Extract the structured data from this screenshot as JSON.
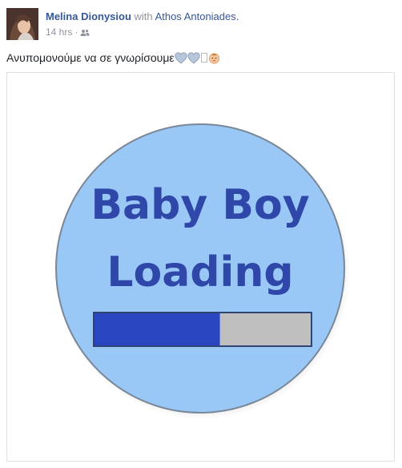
{
  "post": {
    "author": "Melina Dionysiou",
    "with_word": "with",
    "tagged": "Athos Antoniades.",
    "time": "14 hrs",
    "audience_icon": "friends-icon",
    "text": "Ανυπομονούμε να σε γνωρίσουμε",
    "emojis": [
      "blue-heart-icon",
      "blue-heart-icon",
      "missing-glyph",
      "baby-face-icon"
    ]
  },
  "image": {
    "line1": "Baby Boy",
    "line2": "Loading",
    "progress": 0.58,
    "circle_color": "#99c7f6",
    "text_color": "#2f47a8",
    "bar_fill_color": "#2a45c0",
    "bar_empty_color": "#bfbfbf"
  }
}
